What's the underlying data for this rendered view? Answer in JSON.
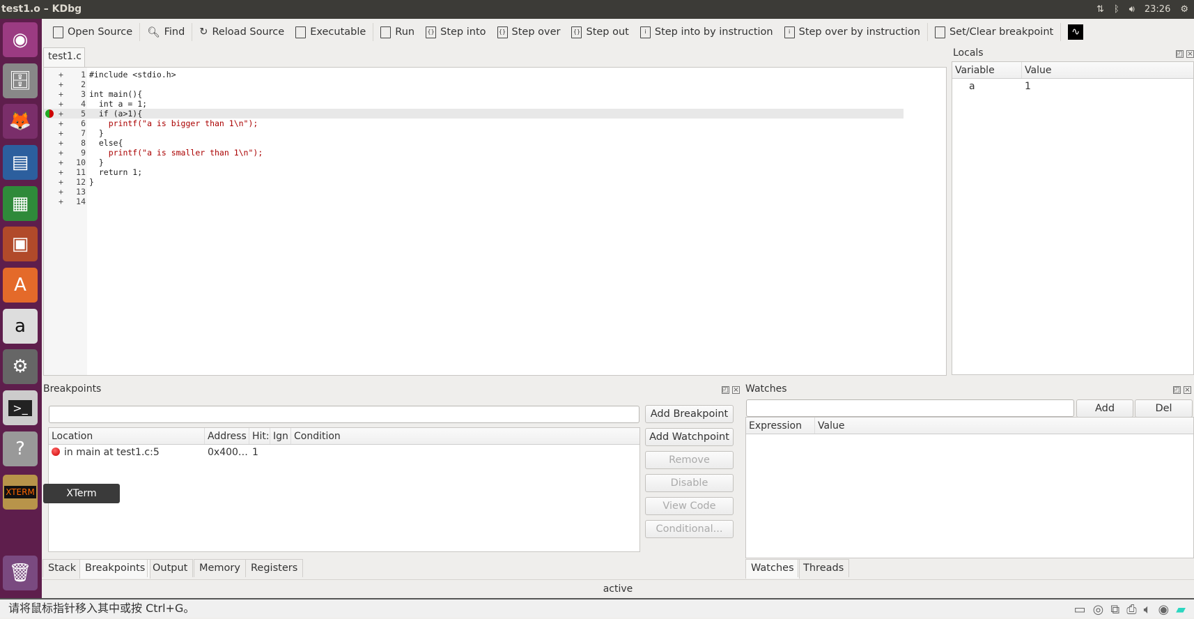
{
  "window": {
    "title": "test1.o – KDbg",
    "clock": "23:26"
  },
  "launcher": {
    "tooltip": "XTerm",
    "items": [
      "ubuntu-dash",
      "files",
      "firefox",
      "writer",
      "calc",
      "impress",
      "software-center",
      "amazon",
      "system-settings",
      "terminal",
      "help",
      "xterm",
      "trash"
    ]
  },
  "toolbar": {
    "items": [
      "Open Source",
      "Find",
      "Reload Source",
      "Executable",
      "Run",
      "Step into",
      "Step over",
      "Step out",
      "Step into by instruction",
      "Step over by instruction",
      "Set/Clear breakpoint"
    ]
  },
  "editor": {
    "tab": "test1.c",
    "current_line": 5,
    "breakpoint_line": 5,
    "lines": [
      "#include <stdio.h>",
      "",
      "int main(){",
      "  int a = 1;",
      "  if (a>1){",
      "    printf(\"a is bigger than 1\\n\");",
      "  }",
      "  else{",
      "    printf(\"a is smaller than 1\\n\");",
      "  }",
      "  return 1;",
      "}",
      "",
      ""
    ]
  },
  "locals": {
    "title": "Locals",
    "columns": [
      "Variable",
      "Value"
    ],
    "rows": [
      {
        "variable": "a",
        "value": "1"
      }
    ]
  },
  "breakpoints": {
    "title": "Breakpoints",
    "input_value": "",
    "columns": [
      "Location",
      "Address",
      "Hit:",
      "Ign",
      "Condition"
    ],
    "rows": [
      {
        "location": "in main at test1.c:5",
        "address": "0x400…",
        "hits": "1",
        "ign": "",
        "condition": ""
      }
    ],
    "buttons": [
      {
        "label": "Add Breakpoint",
        "enabled": true
      },
      {
        "label": "Add Watchpoint",
        "enabled": true
      },
      {
        "label": "Remove",
        "enabled": false
      },
      {
        "label": "Disable",
        "enabled": false
      },
      {
        "label": "View Code",
        "enabled": false
      },
      {
        "label": "Conditional...",
        "enabled": false
      }
    ]
  },
  "bottom_tabs": {
    "items": [
      "Stack",
      "Breakpoints",
      "Output",
      "Memory",
      "Registers"
    ],
    "active": "Breakpoints"
  },
  "watches": {
    "title": "Watches",
    "input_value": "",
    "add": "Add",
    "del": "Del",
    "columns": [
      "Expression",
      "Value"
    ],
    "tabs": [
      "Watches",
      "Threads"
    ],
    "active": "Watches"
  },
  "status": {
    "text": "active"
  },
  "vm_bar": {
    "hint": "请将鼠标指针移入其中或按 Ctrl+G。"
  }
}
